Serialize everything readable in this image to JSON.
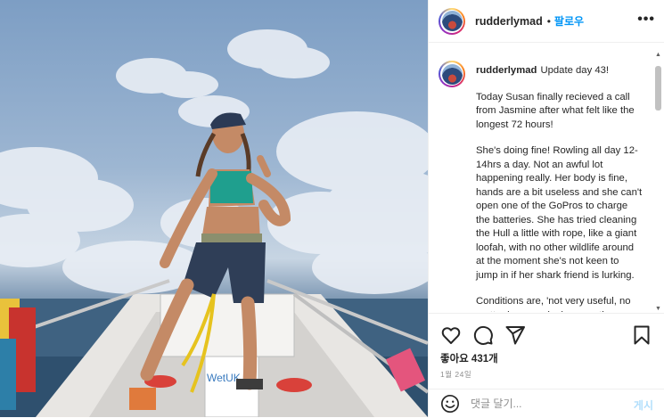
{
  "post_image": {
    "description_icon": "photo-of-rower-on-boat",
    "boat_text": "WetUK"
  },
  "header": {
    "username": "rudderlymad",
    "separator": "•",
    "follow_label": "팔로우",
    "more_icon": "more-options-icon",
    "more_label": "•••"
  },
  "caption": {
    "username": "rudderlymad",
    "paragraphs": [
      "Update day 43!",
      "Today Susan finally recieved a call from Jasmine after what felt like the longest 72 hours!",
      "She's doing fine! Rowling all day 12-14hrs a day. Not an awful lot happening really. Her body is fine, hands are a bit useless and she can't open one of the GoPros to charge the batteries. She has tried cleaning the Hull a little with rope, like a giant loofah, with no other wildlife around at the moment she's not keen to jump in if her shark friend is lurking.",
      "Conditions are, 'not very useful, no matter how much she rows there doesn't seem to be much progress'"
    ]
  },
  "actions": {
    "like_icon": "heart-icon",
    "comment_icon": "comment-icon",
    "share_icon": "share-icon",
    "save_icon": "bookmark-icon",
    "likes_text": "좋아요 431개",
    "date_text": "1월 24일"
  },
  "comment_bar": {
    "emoji_icon": "smiley-icon",
    "placeholder": "댓글 달기...",
    "post_label": "게시"
  },
  "colors": {
    "accent": "#0095f6",
    "text": "#262626",
    "muted": "#8e8e8e",
    "border": "#efefef"
  }
}
